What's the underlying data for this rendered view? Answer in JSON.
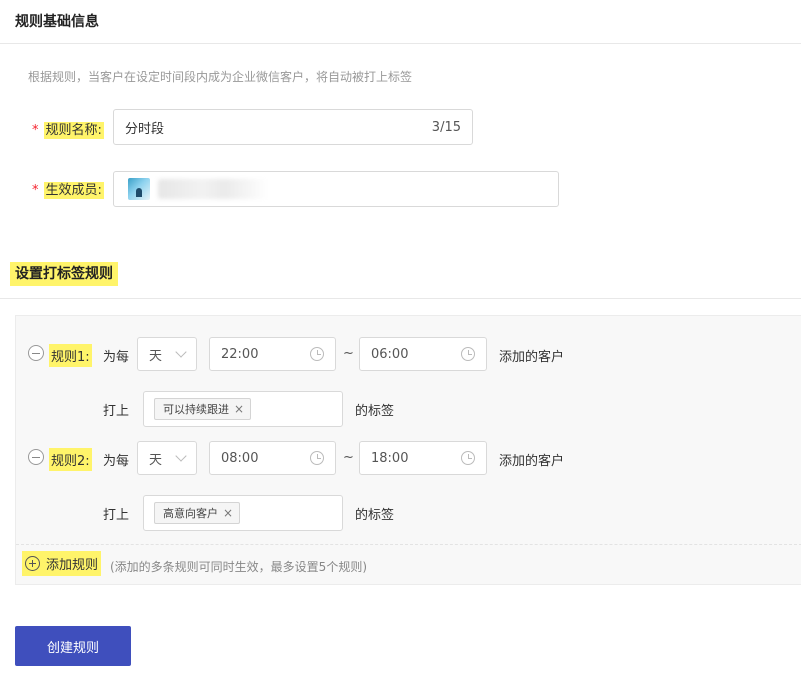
{
  "basic": {
    "title": "规则基础信息",
    "hint": "根据规则，当客户在设定时间段内成为企业微信客户，将自动被打上标签",
    "name_label": "规则名称:",
    "name_value": "分时段",
    "name_count": "3/15",
    "members_label": "生效成员:",
    "required_mark": "*"
  },
  "rules_section": {
    "title": "设置打标签规则",
    "rules": [
      {
        "label": "规则1:",
        "per_text": "为每",
        "period": "天",
        "start_time": "22:00",
        "end_time": "06:00",
        "tilde": "~",
        "added_text": "添加的客户",
        "tag_prefix": "打上",
        "tag": "可以持续跟进",
        "tag_suffix": "的标签"
      },
      {
        "label": "规则2:",
        "per_text": "为每",
        "period": "天",
        "start_time": "08:00",
        "end_time": "18:00",
        "tilde": "~",
        "added_text": "添加的客户",
        "tag_prefix": "打上",
        "tag": "高意向客户",
        "tag_suffix": "的标签"
      }
    ],
    "add_rule_label": "添加规则",
    "add_rule_note": "(添加的多条规则可同时生效，最多设置5个规则)"
  },
  "actions": {
    "create_label": "创建规则"
  },
  "colors": {
    "highlight": "#fff46a",
    "primary_button": "#3f4fbd",
    "required": "#f5222d"
  }
}
